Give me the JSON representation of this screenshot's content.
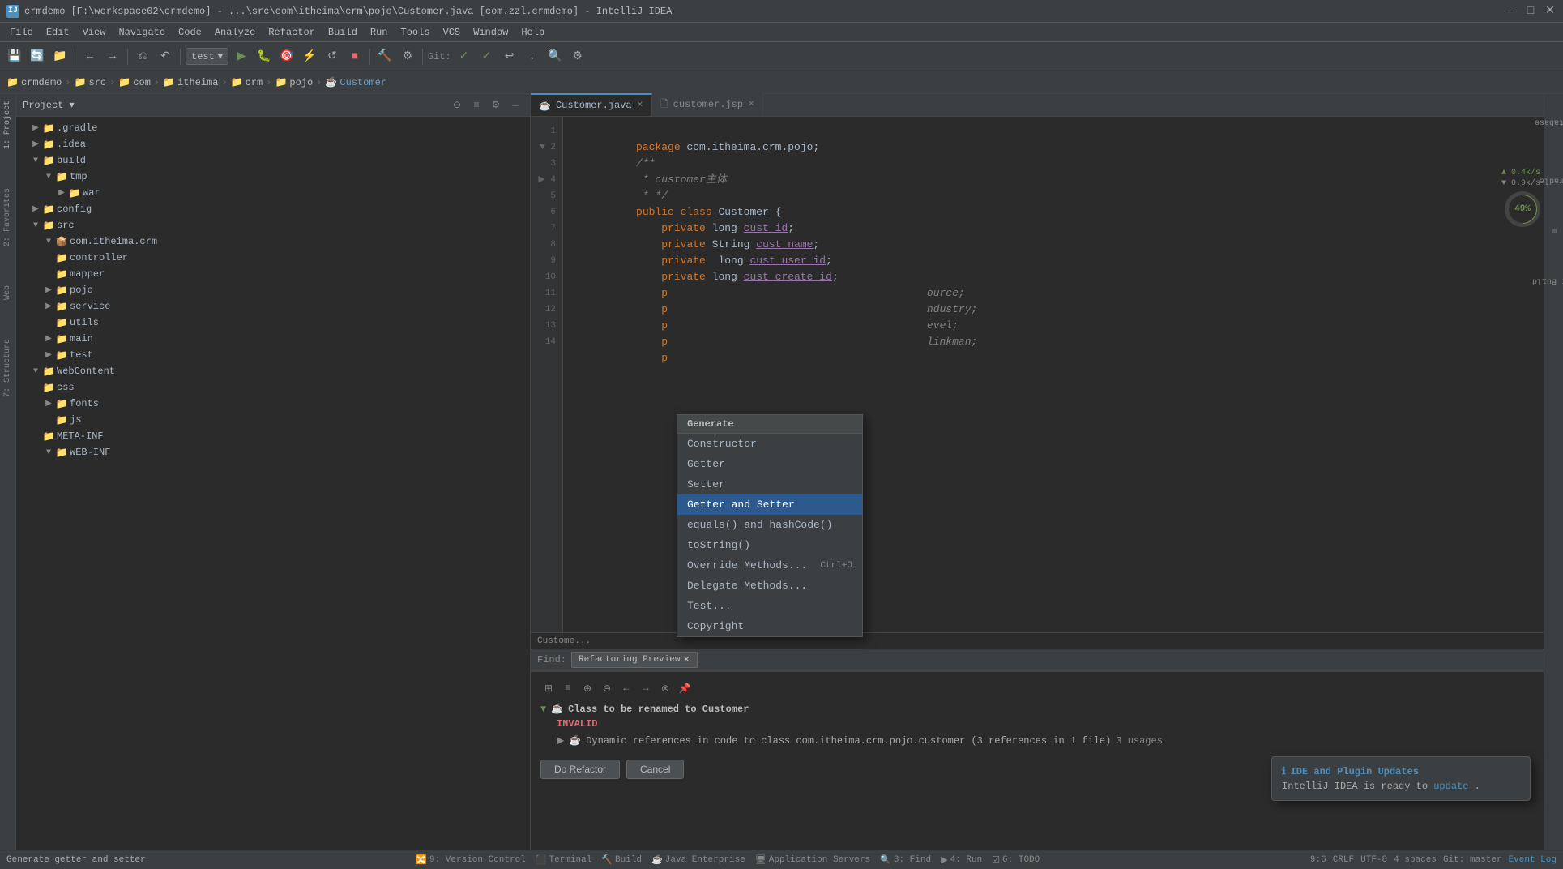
{
  "titleBar": {
    "text": "crmdemo [F:\\workspace02\\crmdemo] - ...\\src\\com\\itheima\\crm\\pojo\\Customer.java [com.zzl.crmdemo] - IntelliJ IDEA",
    "icon": "IJ",
    "controls": [
      "—",
      "□",
      "✕"
    ]
  },
  "menuBar": {
    "items": [
      "File",
      "Edit",
      "View",
      "Navigate",
      "Code",
      "Analyze",
      "Refactor",
      "Build",
      "Run",
      "Tools",
      "VCS",
      "Window",
      "Help"
    ]
  },
  "toolbar": {
    "dropdown": "test",
    "gitLabel": "Git:",
    "buttons": [
      "save",
      "sync",
      "back",
      "forward",
      "open",
      "run",
      "debug",
      "coverage",
      "profile",
      "rerun",
      "stop",
      "build",
      "analyze",
      "git-fetch",
      "git-update",
      "git-push",
      "search",
      "terminal"
    ]
  },
  "breadcrumb": {
    "items": [
      "crmdemo",
      "src",
      "com",
      "itheima",
      "crm",
      "pojo",
      "Customer"
    ]
  },
  "sidebar": {
    "title": "Project",
    "tree": [
      {
        "label": ".gradle",
        "type": "folder",
        "indent": 1,
        "expanded": false
      },
      {
        "label": ".idea",
        "type": "folder",
        "indent": 1,
        "expanded": false
      },
      {
        "label": "build",
        "type": "folder",
        "indent": 1,
        "expanded": true
      },
      {
        "label": "tmp",
        "type": "folder",
        "indent": 2,
        "expanded": true
      },
      {
        "label": "war",
        "type": "folder",
        "indent": 3,
        "expanded": false
      },
      {
        "label": "config",
        "type": "folder",
        "indent": 1,
        "expanded": false
      },
      {
        "label": "src",
        "type": "folder",
        "indent": 1,
        "expanded": true
      },
      {
        "label": "com.itheima.crm",
        "type": "folder",
        "indent": 2,
        "expanded": true
      },
      {
        "label": "controller",
        "type": "folder",
        "indent": 3,
        "expanded": false
      },
      {
        "label": "mapper",
        "type": "folder",
        "indent": 3,
        "expanded": false
      },
      {
        "label": "pojo",
        "type": "folder",
        "indent": 3,
        "expanded": false
      },
      {
        "label": "service",
        "type": "folder",
        "indent": 3,
        "expanded": false
      },
      {
        "label": "utils",
        "type": "folder",
        "indent": 4,
        "expanded": false
      },
      {
        "label": "main",
        "type": "folder",
        "indent": 2,
        "expanded": false
      },
      {
        "label": "test",
        "type": "folder",
        "indent": 2,
        "expanded": false
      },
      {
        "label": "WebContent",
        "type": "folder",
        "indent": 1,
        "expanded": true
      },
      {
        "label": "css",
        "type": "folder",
        "indent": 2,
        "expanded": false
      },
      {
        "label": "fonts",
        "type": "folder",
        "indent": 2,
        "expanded": false
      },
      {
        "label": "js",
        "type": "folder",
        "indent": 3,
        "expanded": false
      },
      {
        "label": "META-INF",
        "type": "folder",
        "indent": 2,
        "expanded": false
      },
      {
        "label": "WEB-INF",
        "type": "folder",
        "indent": 2,
        "expanded": false
      }
    ]
  },
  "tabs": [
    {
      "label": "Customer.java",
      "icon": "java",
      "active": true
    },
    {
      "label": "customer.jsp",
      "icon": "jsp",
      "active": false
    }
  ],
  "codeLines": [
    {
      "num": 1,
      "code": "package com.itheima.crm.pojo;"
    },
    {
      "num": 2,
      "code": "/**"
    },
    {
      "num": 3,
      "code": " * customer主体"
    },
    {
      "num": 4,
      "code": " * */"
    },
    {
      "num": 5,
      "code": "public class Customer {"
    },
    {
      "num": 6,
      "code": "    private long cust_id;"
    },
    {
      "num": 7,
      "code": "    private String cust_name;"
    },
    {
      "num": 8,
      "code": "    private  long cust_user_id;"
    },
    {
      "num": 9,
      "code": "    private long cust_create_id;"
    },
    {
      "num": 10,
      "code": "    p"
    },
    {
      "num": 11,
      "code": "    p"
    },
    {
      "num": 12,
      "code": "    p"
    },
    {
      "num": 13,
      "code": "    p"
    },
    {
      "num": 14,
      "code": "    p"
    }
  ],
  "contextMenu": {
    "header": "Generate",
    "items": [
      {
        "label": "Constructor",
        "shortcut": ""
      },
      {
        "label": "Getter",
        "shortcut": ""
      },
      {
        "label": "Setter",
        "shortcut": ""
      },
      {
        "label": "Getter and Setter",
        "shortcut": "",
        "highlighted": true
      },
      {
        "label": "equals() and hashCode()",
        "shortcut": ""
      },
      {
        "label": "toString()",
        "shortcut": ""
      },
      {
        "label": "Override Methods...",
        "shortcut": "Ctrl+O"
      },
      {
        "label": "Delegate Methods...",
        "shortcut": ""
      },
      {
        "label": "Test...",
        "shortcut": ""
      },
      {
        "label": "Copyright",
        "shortcut": ""
      }
    ]
  },
  "bottomPanel": {
    "findLabel": "Find:",
    "tabs": [
      {
        "label": "Refactoring Preview",
        "active": true,
        "closeable": true
      }
    ],
    "refactorHeader": "Class to be renamed to Customer",
    "invalidLabel": "INVALID",
    "subItem": "Dynamic references in code to class com.itheima.crm.pojo.customer (3 references in 1 file)",
    "usages": "3 usages",
    "buttons": [
      "Do Refactor",
      "Cancel"
    ]
  },
  "statusBar": {
    "left": [
      "9: Version Control",
      "Terminal",
      "Build",
      "Java Enterprise",
      "Application Servers",
      "3: Find",
      "4: Run",
      "6: TODO"
    ],
    "right": [
      "9:6",
      "CRLF",
      "UTF-8",
      "4 spaces",
      "Git: master",
      "Event Log"
    ],
    "statusText": "Generate getter and setter"
  },
  "notification": {
    "title": "IDE and Plugin Updates",
    "body": "IntelliJ IDEA is ready to",
    "link": "update"
  },
  "network": {
    "up": "▲ 0.4k/s",
    "down": "▼ 0.9k/s",
    "cpu": "49%"
  }
}
